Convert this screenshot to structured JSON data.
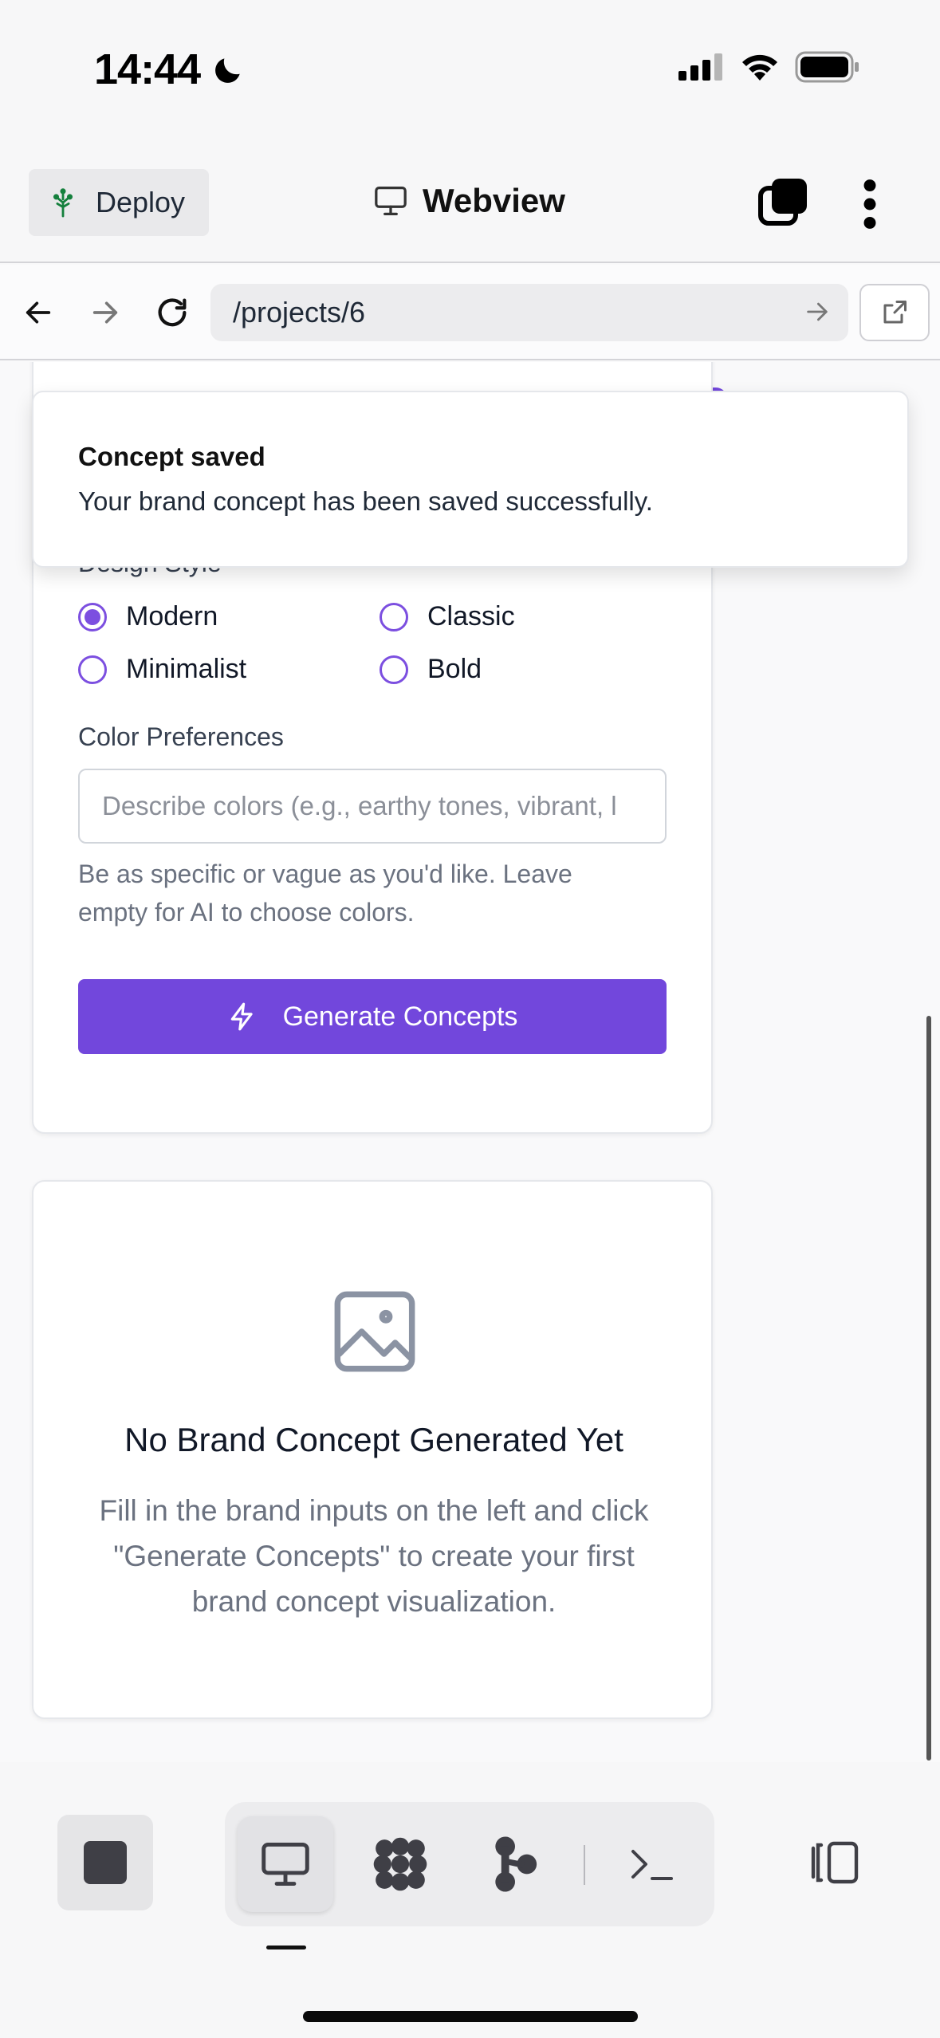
{
  "status_bar": {
    "time": "14:44",
    "icons": [
      "moon-icon",
      "cellular-signal-icon",
      "wifi-icon",
      "battery-icon"
    ]
  },
  "header": {
    "deploy_label": "Deploy",
    "title": "Webview",
    "icons": [
      "deploy-tree-icon",
      "monitor-icon",
      "tabs-icon",
      "more-vertical-icon"
    ]
  },
  "browser": {
    "url": "/projects/6"
  },
  "toast": {
    "title": "Concept saved",
    "message": "Your brand concept has been saved successfully."
  },
  "form": {
    "design_style_label": "Design Style",
    "styles": [
      {
        "label": "Modern",
        "selected": true
      },
      {
        "label": "Classic",
        "selected": false
      },
      {
        "label": "Minimalist",
        "selected": false
      },
      {
        "label": "Bold",
        "selected": false
      }
    ],
    "color_label": "Color Preferences",
    "color_placeholder": "Describe colors (e.g., earthy tones, vibrant, l",
    "color_value": "",
    "helper": "Be as specific or vague as you'd like. Leave empty for AI to choose colors.",
    "generate_label": "Generate Concepts"
  },
  "empty_state": {
    "title": "No Brand Concept Generated Yet",
    "description": "Fill in the brand inputs on the left and click \"Generate Concepts\" to create your first brand concept visualization."
  },
  "colors": {
    "accent": "#7247dc",
    "radio": "#7c4fe0",
    "text_muted": "#6b7280"
  },
  "bottom_bar": {
    "items": [
      "stop-icon",
      "monitor-icon",
      "apps-grid-icon",
      "git-branch-icon",
      "terminal-icon",
      "panel-toggle-icon"
    ],
    "active": "monitor-icon"
  }
}
